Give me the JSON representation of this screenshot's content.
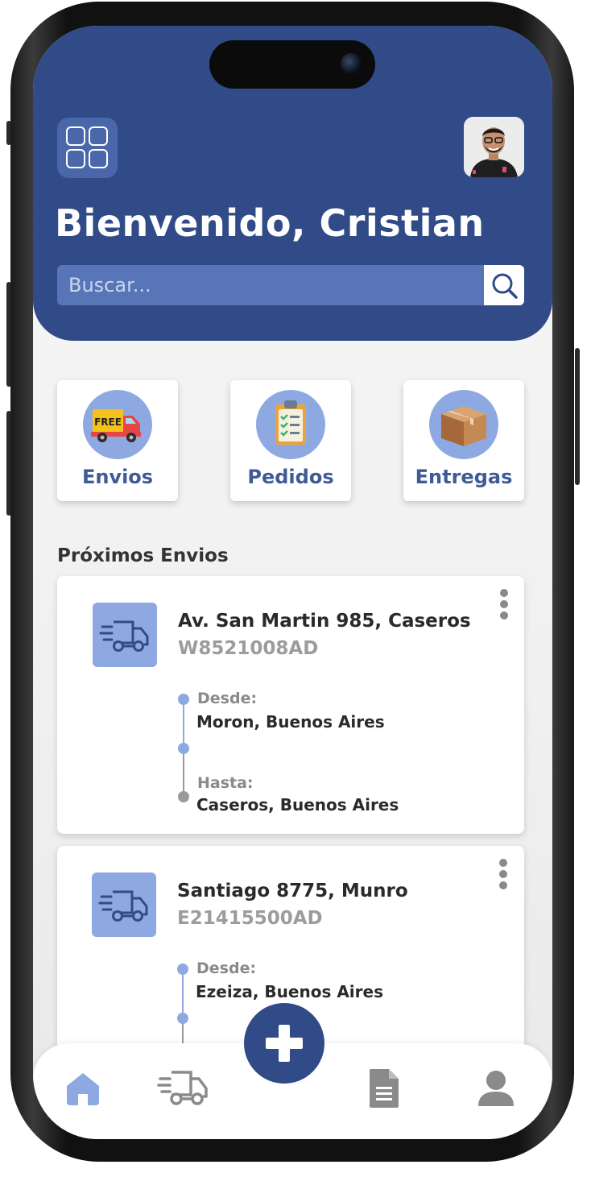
{
  "header": {
    "welcome": "Bienvenido, Cristian",
    "search_placeholder": "Buscar..."
  },
  "categories": [
    {
      "label": "Envios",
      "icon": "free-delivery-truck-icon"
    },
    {
      "label": "Pedidos",
      "icon": "clipboard-checklist-icon"
    },
    {
      "label": "Entregas",
      "icon": "package-box-icon"
    }
  ],
  "section_title": "Próximos Envios",
  "shipments": [
    {
      "address": "Av. San Martin 985, Caseros",
      "code": "W8521008AD",
      "from_label": "Desde:",
      "from": "Moron, Buenos Aires",
      "to_label": "Hasta:",
      "to": "Caseros, Buenos Aires"
    },
    {
      "address": "Santiago 8775, Munro",
      "code": "E21415500AD",
      "from_label": "Desde:",
      "from": "Ezeiza, Buenos Aires"
    }
  ],
  "tabbar": {
    "items": [
      "home-icon",
      "truck-icon",
      "add-icon",
      "document-icon",
      "user-icon"
    ],
    "active": "home-icon"
  },
  "colors": {
    "primary": "#304b87",
    "accent": "#8ea9e2",
    "search_bg": "#5876b7",
    "label": "#3f5b97"
  }
}
